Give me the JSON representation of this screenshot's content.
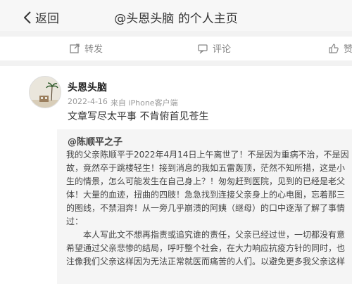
{
  "header": {
    "back_label": "返回",
    "title": "@头恩头脑 的个人主页"
  },
  "actions": {
    "repost_label": "转发",
    "comment_label": "评论",
    "like_label": "赞"
  },
  "post": {
    "username": "头恩头脑",
    "date": "2022-4-16",
    "source": "来自 iPhone客户端",
    "text": "文章写尽太平事 不肯俯首见苍生"
  },
  "quote": {
    "author": "@陈顺平之子",
    "lines": [
      "我的父亲陈顺平于2022年4月14日上午离世了！不是因为重病不治，不是因",
      "故，竟然卒于跳楼轻生！接到消息的我如五雷轰顶，茫然不知所措，这是小",
      "生的情景，怎么可能发生在自己身上？！匆匆赶到医院，见到的已经是老父",
      "体！大量的血迹，扭曲的四肢！急急找到连接父亲身上的心电图，忘着那三",
      "的图线，不禁泪奔！从一旁几乎崩溃的阿姨（继母）的口中逐渐了解了事情",
      "过：",
      "本人写此文不想再指责或追究谁的责任，父亲已经过世，一切都没有意",
      "希望通过父亲悲惨的结局，呼吁整个社会，在大力响应抗疫方针的同时，也",
      "注像我们父亲这样因为无法正常就医而痛苦的人们。以避免更多我父亲这样"
    ]
  },
  "colors": {
    "page_bg": "#f2f2f2",
    "card_bg": "#ffffff",
    "quote_bg": "#f5f5f5",
    "muted_text": "#999999"
  }
}
